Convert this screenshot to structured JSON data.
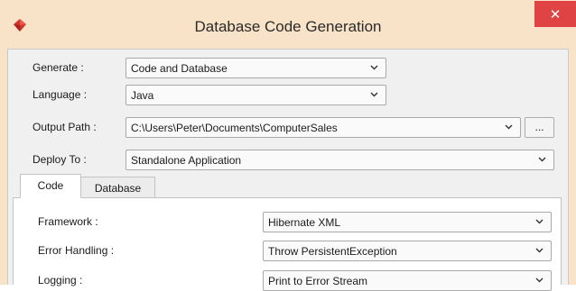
{
  "window": {
    "title": "Database Code Generation",
    "close_glyph": "✕",
    "accent": "#e04343",
    "titlebar_color": "#f9e3c8"
  },
  "form": {
    "generate": {
      "label": "Generate :",
      "value": "Code and Database"
    },
    "language": {
      "label": "Language :",
      "value": "Java"
    },
    "output_path": {
      "label": "Output Path :",
      "value": "C:\\Users\\Peter\\Documents\\ComputerSales",
      "browse_label": "..."
    },
    "deploy_to": {
      "label": "Deploy To :",
      "value": "Standalone Application"
    }
  },
  "tabs": [
    {
      "label": "Code",
      "active": true
    },
    {
      "label": "Database",
      "active": false
    }
  ],
  "code_tab": {
    "framework": {
      "label": "Framework :",
      "value": "Hibernate XML"
    },
    "error_handling": {
      "label": "Error Handling :",
      "value": "Throw PersistentException"
    },
    "logging": {
      "label": "Logging :",
      "value": "Print to Error Stream"
    }
  },
  "icons": {
    "app": "app-logo-icon",
    "close": "close-icon",
    "dropdown": "chevron-down-icon"
  }
}
